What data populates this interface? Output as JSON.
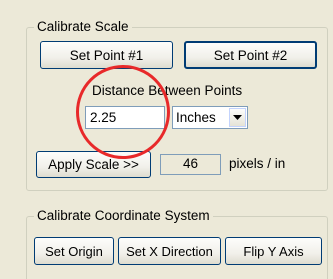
{
  "calibrate_scale": {
    "title": "Calibrate Scale",
    "set_point_1_label": "Set Point #1",
    "set_point_2_label": "Set Point #2",
    "distance_label": "Distance Between Points",
    "distance_value": "2.25",
    "units": {
      "selected": "Inches",
      "icon": "chevron-down-icon"
    },
    "apply_scale_label": "Apply Scale >>",
    "scale_value": "46",
    "scale_units_label": "pixels / in"
  },
  "calibrate_coordinates": {
    "title": "Calibrate Coordinate System",
    "set_origin_label": "Set Origin",
    "set_x_direction_label": "Set X Direction",
    "flip_y_axis_label": "Flip Y Axis"
  },
  "annotation": {
    "shape": "circle",
    "color": "#e8292a"
  }
}
